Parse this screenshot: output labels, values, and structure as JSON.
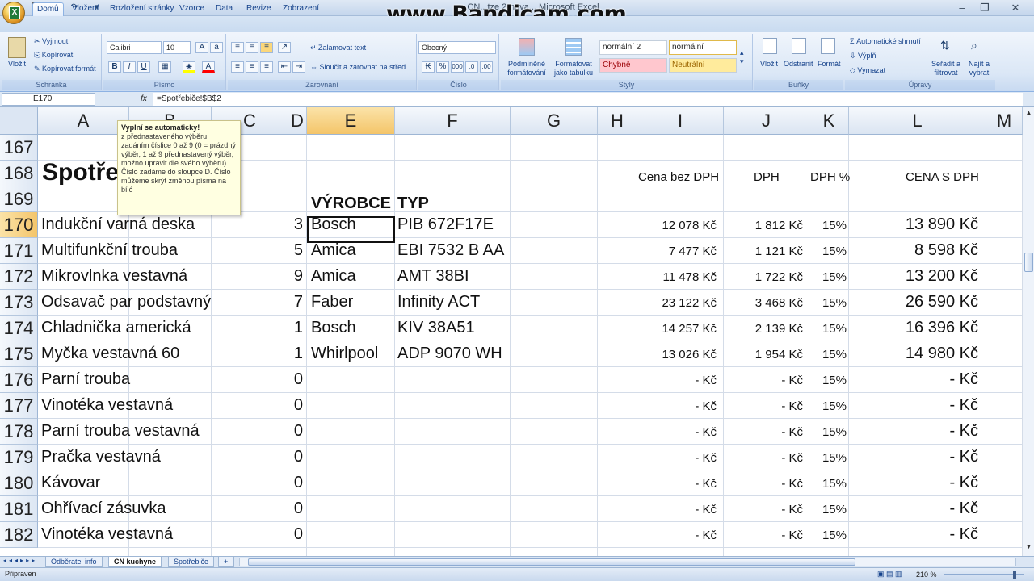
{
  "window": {
    "title": "CN...tze 2-nova... Microsoft Excel",
    "watermark": "www.Bandicam.com",
    "quick_access": [
      "save-icon",
      "undo-icon",
      "redo-icon",
      "customize-icon"
    ],
    "controls": [
      "–",
      "❐",
      "✕"
    ]
  },
  "ribbon_tabs": [
    "Domů",
    "Vložení",
    "Rozložení stránky",
    "Vzorce",
    "Data",
    "Revize",
    "Zobrazení"
  ],
  "ribbon": {
    "clipboard": {
      "paste": "Vložit",
      "cut": "Vyjmout",
      "copy": "Kopírovat",
      "format_painter": "Kopírovat formát",
      "label": "Schránka"
    },
    "font": {
      "name": "Calibri",
      "size": "10",
      "label": "Písmo",
      "bold": "B",
      "italic": "I",
      "underline": "U"
    },
    "alignment": {
      "wrap": "Zalamovat text",
      "merge": "Sloučit a zarovnat na střed",
      "label": "Zarovnání"
    },
    "number": {
      "format": "Obecný",
      "label": "Číslo",
      "currency": "%",
      "thousands": "000",
      "inc": ",0",
      "dec": ",00"
    },
    "styles": {
      "cond_format": "Podmíněné formátování",
      "table_format": "Formátovat jako tabulku",
      "s1": "normální 2",
      "s2": "normální",
      "s3": "Chybně",
      "s4": "Neutrální",
      "label": "Styly"
    },
    "cells": {
      "insert": "Vložit",
      "delete": "Odstranit",
      "format": "Formát",
      "label": "Buňky"
    },
    "editing": {
      "autosum": "Automatické shrnutí",
      "fill": "Výplň",
      "clear": "Vymazat",
      "sort": "Seřadit a filtrovat",
      "find": "Najít a vybrat",
      "label": "Úpravy"
    }
  },
  "formula_bar": {
    "name_box": "E170",
    "fx": "fx",
    "formula": "=Spotřebiče!$B$2"
  },
  "columns": [
    "A",
    "B",
    "C",
    "D",
    "E",
    "F",
    "G",
    "H",
    "I",
    "J",
    "K",
    "L",
    "M"
  ],
  "selected_column": "E",
  "selected_row": "170",
  "tooltip": {
    "title": "Vyplní se automaticky!",
    "body": "z přednastaveného výběru zadáním číslice 0 až 9 (0 = prázdný výběr, 1 až 9 přednastavený výběr, možno upravit dle svého výběru). Číslo zadáme do sloupce D. Číslo můžeme skrýt změnou písma na bílé"
  },
  "header_rows": {
    "r167": {
      "row": "167"
    },
    "r168": {
      "row": "168",
      "a": "Spotře",
      "i": "Cena bez DPH",
      "j": "DPH",
      "k": "DPH %",
      "l": "CENA S DPH"
    },
    "r169": {
      "row": "169",
      "e": "VÝROBCE",
      "f": "TYP"
    }
  },
  "rows": [
    {
      "row": "170",
      "a": "Indukční varná deska",
      "d": "3",
      "e": "Bosch",
      "f": "PIB 672F17E",
      "i": "12 078 Kč",
      "j": "1 812 Kč",
      "k": "15%",
      "l": "13 890 Kč"
    },
    {
      "row": "171",
      "a": "Multifunkční trouba",
      "d": "5",
      "e": "Amica",
      "f": "EBI 7532 B AA",
      "i": "7 477 Kč",
      "j": "1 121 Kč",
      "k": "15%",
      "l": "8 598 Kč"
    },
    {
      "row": "172",
      "a": "Mikrovlnka vestavná",
      "d": "9",
      "e": "Amica",
      "f": "AMT 38BI",
      "i": "11 478 Kč",
      "j": "1 722 Kč",
      "k": "15%",
      "l": "13 200 Kč"
    },
    {
      "row": "173",
      "a": "Odsavač par podstavný",
      "d": "7",
      "e": "Faber",
      "f": "Infinity ACT",
      "i": "23 122 Kč",
      "j": "3 468 Kč",
      "k": "15%",
      "l": "26 590 Kč"
    },
    {
      "row": "174",
      "a": "Chladnička americká",
      "d": "1",
      "e": "Bosch",
      "f": "KIV 38A51",
      "i": "14 257 Kč",
      "j": "2 139 Kč",
      "k": "15%",
      "l": "16 396 Kč"
    },
    {
      "row": "175",
      "a": "Myčka vestavná 60",
      "d": "1",
      "e": "Whirlpool",
      "f": "ADP 9070 WH",
      "i": "13 026 Kč",
      "j": "1 954 Kč",
      "k": "15%",
      "l": "14 980 Kč"
    },
    {
      "row": "176",
      "a": "Parní trouba",
      "d": "0",
      "e": "",
      "f": "",
      "i": "-   Kč",
      "j": "-   Kč",
      "k": "15%",
      "l": "-   Kč"
    },
    {
      "row": "177",
      "a": "Vinotéka vestavná",
      "d": "0",
      "e": "",
      "f": "",
      "i": "-   Kč",
      "j": "-   Kč",
      "k": "15%",
      "l": "-   Kč"
    },
    {
      "row": "178",
      "a": "Parní trouba vestavná",
      "d": "0",
      "e": "",
      "f": "",
      "i": "-   Kč",
      "j": "-   Kč",
      "k": "15%",
      "l": "-   Kč"
    },
    {
      "row": "179",
      "a": "Pračka vestavná",
      "d": "0",
      "e": "",
      "f": "",
      "i": "-   Kč",
      "j": "-   Kč",
      "k": "15%",
      "l": "-   Kč"
    },
    {
      "row": "180",
      "a": "Kávovar",
      "d": "0",
      "e": "",
      "f": "",
      "i": "-   Kč",
      "j": "-   Kč",
      "k": "15%",
      "l": "-   Kč"
    },
    {
      "row": "181",
      "a": "Ohřívací zásuvka",
      "d": "0",
      "e": "",
      "f": "",
      "i": "-   Kč",
      "j": "-   Kč",
      "k": "15%",
      "l": "-   Kč"
    },
    {
      "row": "182",
      "a": "Vinotéka vestavná",
      "d": "0",
      "e": "",
      "f": "",
      "i": "-   Kč",
      "j": "-   Kč",
      "k": "15%",
      "l": "-   Kč"
    }
  ],
  "sheet_tabs": [
    "Odběratel info",
    "CN kuchyne",
    "Spotřebiče"
  ],
  "active_sheet": "CN kuchyne",
  "status": {
    "ready": "Připraven",
    "zoom": "210 %"
  },
  "colors": {
    "selection": "#f4c56a",
    "ribbon": "#dbe7f6",
    "bad_style": "#ffc7ce",
    "neutral_style": "#ffeb9c"
  }
}
